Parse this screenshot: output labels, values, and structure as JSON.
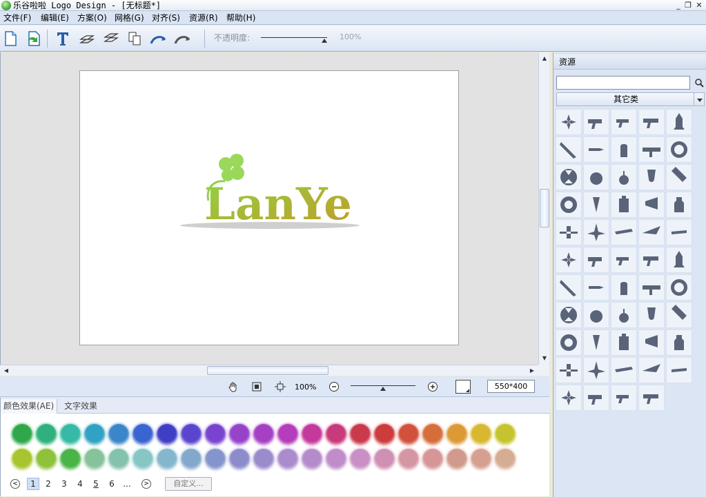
{
  "window": {
    "title": "乐谷啦啦 Logo Design - [无标题*]",
    "controls": {
      "minimize": "_",
      "restore": "❐",
      "close": "✕"
    }
  },
  "menu": [
    {
      "id": "file",
      "label": "文件(F)"
    },
    {
      "id": "edit",
      "label": "编辑(E)"
    },
    {
      "id": "scheme",
      "label": "方案(O)"
    },
    {
      "id": "grid",
      "label": "网格(G)"
    },
    {
      "id": "align",
      "label": "对齐(S)"
    },
    {
      "id": "resource",
      "label": "资源(R)"
    },
    {
      "id": "help",
      "label": "帮助(H)"
    }
  ],
  "toolbar": {
    "buttons": [
      {
        "name": "new-document-button",
        "icon": "new-document-icon"
      },
      {
        "name": "open-document-button",
        "icon": "open-document-icon"
      },
      {
        "name": "insert-text-button",
        "icon": "text-icon"
      },
      {
        "name": "bring-forward-button",
        "icon": "bring-forward-icon"
      },
      {
        "name": "send-backward-button",
        "icon": "send-backward-icon"
      },
      {
        "name": "duplicate-button",
        "icon": "copy-icon"
      },
      {
        "name": "flip-horizontal-button",
        "icon": "flip-horizontal-icon"
      },
      {
        "name": "flip-vertical-button",
        "icon": "flip-vertical-icon"
      }
    ],
    "opacity_label": "不透明度:",
    "opacity_value": "100%",
    "opacity_level": 1.0
  },
  "canvas": {
    "logo_text": "LanYe",
    "colors": {
      "green": "#7fcf3e",
      "gold": "#c8a02a",
      "shadow": "#c8c8c8"
    }
  },
  "statusbar": {
    "zoom_value": "100%",
    "zoom_level": 0.5,
    "canvas_size": "550*400",
    "fill_color": "#ffffff"
  },
  "bottom": {
    "tabs": [
      {
        "id": "color",
        "label": "颜色效果(AE)",
        "active": true
      },
      {
        "id": "text",
        "label": "文字效果",
        "active": false
      }
    ],
    "swatch_rows": [
      [
        "#2ea84a",
        "#2fb07d",
        "#36b9a6",
        "#31a1c4",
        "#3a86c8",
        "#3a64cf",
        "#3f3fc6",
        "#5a45cf",
        "#7a43cf",
        "#9643ca",
        "#a540c4",
        "#b43cbd",
        "#c43a9c",
        "#c83a7b",
        "#c83a4c",
        "#cc3c3c",
        "#d2503c",
        "#d66e3a",
        "#dc9a36",
        "#d8b830",
        "#c6c42e"
      ],
      [
        "#a8c42e",
        "#8ec23a",
        "#4ab446",
        "#86c29a",
        "#84c2ae",
        "#86c6c4",
        "#84b6cc",
        "#84a8cc",
        "#8494cc",
        "#8c8ccc",
        "#9a8ccc",
        "#aa8ccc",
        "#b48ccc",
        "#c08cca",
        "#c890c4",
        "#d090b4",
        "#d496a2",
        "#d69698",
        "#d09a8c",
        "#d6a090",
        "#d6ac94"
      ]
    ],
    "pager": {
      "pages": [
        "1",
        "2",
        "3",
        "4",
        "5",
        "6"
      ],
      "active": "1",
      "ellipsis": "...",
      "prev": "<",
      "next": ">",
      "custom_label": "自定义..."
    }
  },
  "resources": {
    "title": "资源",
    "search_value": "",
    "category": "其它类",
    "icon_color": "#5a6478",
    "items": [
      "propeller-icon",
      "gun-icon",
      "revolver-icon",
      "pistol-icon",
      "rocket-icon",
      "missile-icon",
      "bullet-icon",
      "shell-icon",
      "bazooka-icon",
      "crosshair-icon",
      "radiation-icon",
      "bomb-icon",
      "grenade-icon",
      "aerial-bomb-icon",
      "spray-icon",
      "biohazard-icon",
      "hook-icon",
      "gas-can-icon",
      "gas-mask-icon",
      "bottle-icon",
      "biplane-icon",
      "fighter-jet-icon",
      "jet-icon",
      "bomber-icon",
      "plane-icon",
      "triplane-icon",
      "jet-fighter-icon",
      "stealth-jet-icon",
      "twin-plane-icon",
      "glider-icon",
      "attack-plane-icon",
      "seaplane-icon",
      "drone-icon",
      "tank-icon",
      "warship-icon",
      "prop-plane-icon",
      "airliner-icon",
      "skull-icon",
      "skull-crossbones-icon",
      "skull-bones-icon",
      "astronaut-icon",
      "satellite-dish-icon",
      "radar-icon",
      "antenna-icon",
      "film-reel-icon",
      "film-reel-2-icon",
      "film-reel-3-icon",
      "explosion-icon",
      "spotlight-icon",
      "lightbulb-icon",
      "clapperboard-icon",
      "clapper-2-icon",
      "tripod-light-icon",
      "easel-icon"
    ]
  }
}
